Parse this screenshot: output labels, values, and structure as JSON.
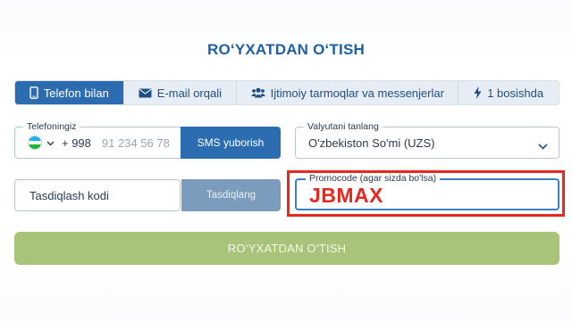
{
  "form": {
    "title": "RO‘YXATDAN O‘TISH",
    "tabs": [
      {
        "label": "Telefon bilan",
        "icon": "phone-icon",
        "active": true
      },
      {
        "label": "E-mail orqali",
        "icon": "envelope-icon",
        "active": false
      },
      {
        "label": "Ijtimoiy tarmoqlar va messenjerlar",
        "icon": "users-icon",
        "active": false
      },
      {
        "label": "1 bosishda",
        "icon": "lightning-icon",
        "active": false
      }
    ],
    "phone": {
      "label": "Telefoningiz",
      "country_code": "+ 998",
      "placeholder": "91 234 56 78",
      "flag_icon": "uzbekistan-flag-icon",
      "send_sms_label": "SMS yuborish"
    },
    "currency": {
      "label": "Valyutani tanlang",
      "value": "O'zbekiston So'mi (UZS)"
    },
    "confirmation": {
      "placeholder": "Tasdiqlash kodi",
      "confirm_label": "Tasdiqlang"
    },
    "promo": {
      "label": "Promocode (agar sizda bo'lsa)",
      "value": "JBMAX"
    },
    "submit_label": "RO‘YXATDAN O‘TISH"
  },
  "colors": {
    "accent": "#2c6db2",
    "title": "#1f5fa3",
    "submit_disabled": "#a8c47b",
    "highlight": "#e8281e"
  }
}
